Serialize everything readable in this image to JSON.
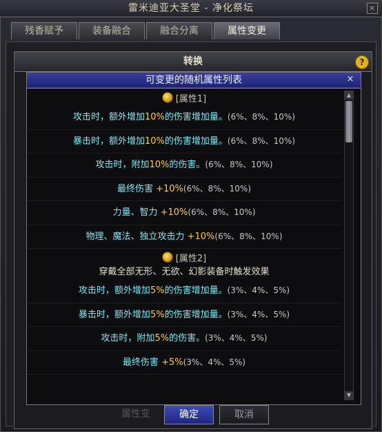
{
  "window": {
    "title": "雷米迪亚大圣堂 - 净化祭坛",
    "close": "×"
  },
  "tabs": [
    {
      "label": "残香赋予"
    },
    {
      "label": "装备融合"
    },
    {
      "label": "融合分离"
    },
    {
      "label": "属性变更"
    }
  ],
  "convert": {
    "title": "转换",
    "help": "?"
  },
  "list": {
    "title": "可变更的随机属性列表",
    "close": "×",
    "group1": {
      "header": "[属性1]",
      "lines": [
        {
          "pre": "攻击时，额外增加",
          "hl": "10%",
          "post": "的伤害增加量。",
          "opt": "(6%、8%、10%)"
        },
        {
          "pre": "暴击时，额外增加",
          "hl": "10%",
          "post": "的伤害增加量。",
          "opt": "(6%、8%、10%)"
        },
        {
          "pre": "攻击时，附加",
          "hl": "10%",
          "post": "的伤害。",
          "opt": "(6%、8%、10%)"
        },
        {
          "pre": "最终伤害 ",
          "hl": "+10%",
          "post": "",
          "opt": "(6%、8%、10%)"
        },
        {
          "pre": "力量、智力 ",
          "hl": "+10%",
          "post": "",
          "opt": "(6%、8%、10%)"
        },
        {
          "pre": "物理、魔法、独立攻击力 ",
          "hl": "+10%",
          "post": "",
          "opt": "(6%、8%、10%)"
        }
      ]
    },
    "group2": {
      "header": "[属性2]",
      "note": "穿戴全部无形、无欲、幻影装备时触发效果",
      "lines": [
        {
          "pre": "攻击时，额外增加",
          "hl": "5%",
          "post": "的伤害增加量。",
          "opt": "(3%、4%、5%)"
        },
        {
          "pre": "暴击时，额外增加",
          "hl": "5%",
          "post": "的伤害增加量。",
          "opt": "(3%、4%、5%)"
        },
        {
          "pre": "攻击时，附加",
          "hl": "5%",
          "post": "的伤害。",
          "opt": "(3%、4%、5%)"
        },
        {
          "pre": "最终伤害 ",
          "hl": "+5%",
          "post": "",
          "opt": "(3%、4%、5%)"
        }
      ]
    }
  },
  "buttons": {
    "confirm": "确定",
    "cancel": "取消"
  },
  "background": {
    "ghost_button": "属性变"
  },
  "colors": {
    "highlight": "#ffcc33",
    "text_main": "#7fe6ef",
    "title_blue": "#1e2275"
  }
}
